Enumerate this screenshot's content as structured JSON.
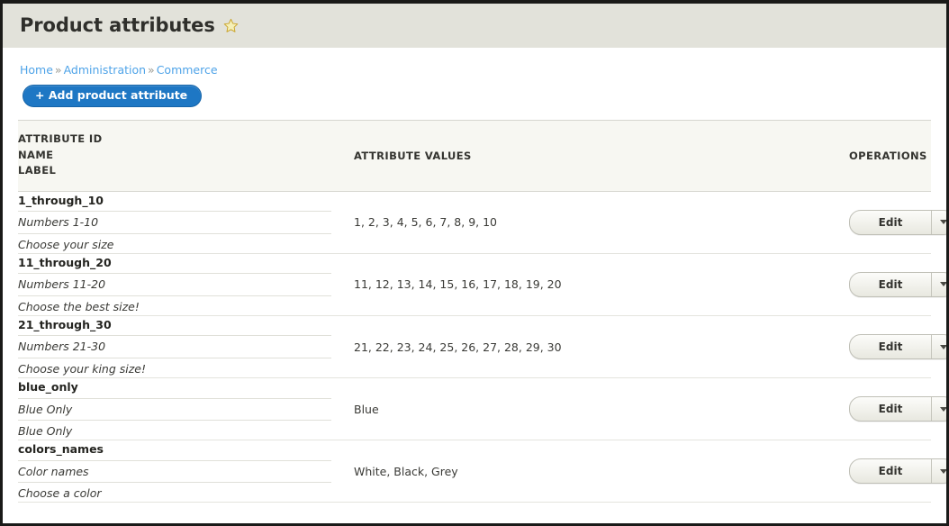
{
  "header": {
    "title": "Product attributes",
    "star_icon": "star-icon"
  },
  "breadcrumb": {
    "separator": "»",
    "items": [
      {
        "label": "Home"
      },
      {
        "label": "Administration"
      },
      {
        "label": "Commerce"
      }
    ]
  },
  "actions": {
    "add_label": "+ Add product attribute"
  },
  "table": {
    "headers": {
      "attribute_id": "ATTRIBUTE ID",
      "name": "NAME",
      "label": "LABEL",
      "attribute_values": "ATTRIBUTE VALUES",
      "operations": "OPERATIONS"
    },
    "operation": {
      "edit_label": "Edit",
      "toggle_icon": "chevron-down-icon"
    },
    "rows": [
      {
        "attribute_id": "1_through_10",
        "name": "Numbers 1-10",
        "label": "Choose your size",
        "values": "1, 2, 3, 4, 5, 6, 7, 8, 9, 10"
      },
      {
        "attribute_id": "11_through_20",
        "name": "Numbers 11-20",
        "label": "Choose the best size!",
        "values": "11, 12, 13, 14, 15, 16, 17, 18, 19, 20"
      },
      {
        "attribute_id": "21_through_30",
        "name": "Numbers 21-30",
        "label": "Choose your king size!",
        "values": "21, 22, 23, 24, 25, 26, 27, 28, 29, 30"
      },
      {
        "attribute_id": "blue_only",
        "name": "Blue Only",
        "label": "Blue Only",
        "values": "Blue"
      },
      {
        "attribute_id": "colors_names",
        "name": "Color names",
        "label": "Choose a color",
        "values": "White, Black, Grey"
      }
    ]
  },
  "colors": {
    "header_band": "#e2e2da",
    "link": "#4ea3e8",
    "primary_button": "#1e77c4",
    "table_header_bg": "#f7f7f2",
    "star_fill": "#f5f0b8",
    "star_stroke": "#c9a227"
  }
}
